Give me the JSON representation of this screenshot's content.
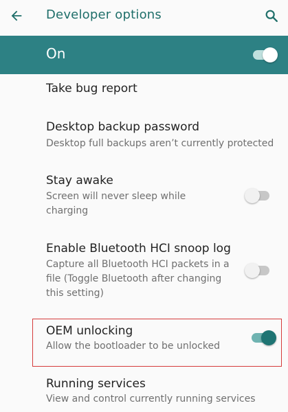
{
  "appbar": {
    "back_icon": "arrow-back-icon",
    "title": "Developer options",
    "search_icon": "search-icon"
  },
  "master": {
    "label": "On",
    "enabled": true
  },
  "settings": [
    {
      "title": "Take bug report"
    },
    {
      "title": "Desktop backup password",
      "summary": "Desktop full backups aren’t currently protected"
    },
    {
      "title": "Stay awake",
      "summary_lines": [
        "Screen will never sleep while",
        "charging"
      ],
      "enabled": false
    },
    {
      "title": "Enable Bluetooth HCI snoop log",
      "summary_lines": [
        "Capture all Bluetooth HCI packets in a",
        "file (Toggle Bluetooth after changing",
        "this setting)"
      ],
      "enabled": false
    },
    {
      "title": "OEM unlocking",
      "summary": "Allow the bootloader to be unlocked",
      "enabled": true,
      "highlighted": true
    },
    {
      "title": "Running services",
      "summary": "View and control currently running services"
    }
  ],
  "colors": {
    "accent": "#2d8184",
    "title_text": "#1f6f6a",
    "highlight_border": "#d53a3a"
  }
}
